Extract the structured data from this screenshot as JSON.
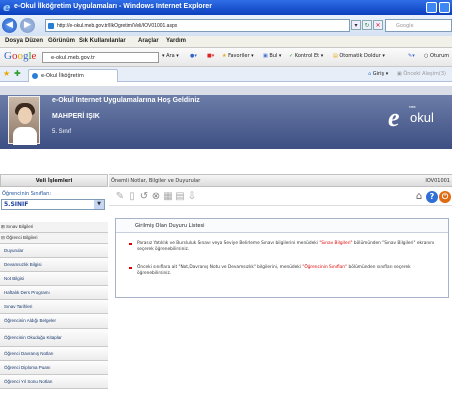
{
  "window": {
    "title": "e-Okul İlköğretim Uygulamaları - Windows Internet Explorer"
  },
  "address": {
    "url": "http://e-okul.meb.gov.tr/IlkOgretim/Veli/IOV01001.aspx",
    "search_placeholder": "Google"
  },
  "menubar": {
    "items": [
      "Dosya",
      "Düzen",
      "Görünüm",
      "Sık Kullanılanlar",
      "Araçlar",
      "Yardım"
    ]
  },
  "googlebar": {
    "logo": "Google",
    "search_value": "e-okul.meb.gov.tr",
    "ara": "Ara",
    "favoriler": "Favoriler",
    "bul": "Bul",
    "kontrol": "Kontrol Et",
    "otomatik": "Otomatik Doldur",
    "oturum": "Oturum"
  },
  "tabbar": {
    "tab_label": "e-Okul İlköğretim Uygulamaları",
    "giris": "Giriş",
    "onay": "Önceki Aleşim(3)"
  },
  "header": {
    "welcome": "e-Okul Internet Uygulamalarına Hoş Geldiniz",
    "student_name": "MAHPERİ IŞIK",
    "student_class": "5. Sınıf",
    "logo_text": "okul",
    "logo_e": "e",
    "logo_meb": "MEB"
  },
  "sidebar": {
    "heading": "Veli İşlemleri",
    "class_label": "Öğrencinin Sınıfları:",
    "class_value": "5.SINIF",
    "items": [
      {
        "label": "⊞ Sınav Bilgileri",
        "group": true
      },
      {
        "label": "⊟ Öğrenci Bilgileri",
        "group": true
      },
      {
        "label": "Duyurular",
        "group": false
      },
      {
        "label": "Devamsızlık Bilgisi",
        "group": false
      },
      {
        "label": "Not Bilgisi",
        "group": false
      },
      {
        "label": "Haftalık Ders Programı",
        "group": false
      },
      {
        "label": "Sınav Tarihleri",
        "group": false
      },
      {
        "label": "Öğrencinin Aldığı Belgeler",
        "group": false
      },
      {
        "label": "Öğrencinin Okuduğu Kitaplar",
        "group": false
      },
      {
        "label": "Öğrenci Davranış Notları",
        "group": false
      },
      {
        "label": "Öğrenci Diploma Puanı",
        "group": false
      },
      {
        "label": "Öğrenci Yıl Sonu Notları",
        "group": false
      }
    ]
  },
  "main": {
    "heading": "Önemli Notlar, Bilgiler ve Duyurular",
    "page_code": "IOV01001",
    "panel_title": "Girilmiş Olan Duyuru Listesi",
    "announcements": [
      {
        "before": "Parasız Yatılılık ve Bursluluk Sınavı veya Seviye Belirleme Sınavı bilgilerini menüdeki ",
        "link": "\"Sınav Bilgileri\"",
        "after": " bölümünden \"Sınav Bilgileri\" ekranını seçerek öğrenebilirsiniz."
      },
      {
        "before": "Önceki sınıflara ait \"Not,Davranış Notu ve Devamsızlık\" bilgilerini, menüdeki ",
        "link": "\"Öğrencinin Sınıfları\"",
        "after": " bölümünden sınıfları seçerek öğrenebilirsiniz."
      }
    ]
  },
  "colors": {
    "header_band": "#4d5f90",
    "title_bar": "#0b3fbd",
    "link_red": "#dd0000",
    "sidebar_text": "#1a3a70"
  }
}
